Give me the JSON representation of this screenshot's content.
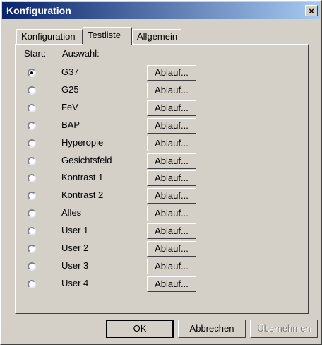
{
  "window": {
    "title": "Konfiguration",
    "close_label": "×"
  },
  "tabs": [
    {
      "label": "Konfiguration",
      "active": false
    },
    {
      "label": "Testliste",
      "active": true
    },
    {
      "label": "Allgemein",
      "active": false
    }
  ],
  "columns": {
    "start": "Start:",
    "auswahl": "Auswahl:"
  },
  "tests": [
    {
      "label": "G37",
      "checked": true,
      "button": "Ablauf..."
    },
    {
      "label": "G25",
      "checked": false,
      "button": "Ablauf..."
    },
    {
      "label": "FeV",
      "checked": false,
      "button": "Ablauf..."
    },
    {
      "label": "BAP",
      "checked": false,
      "button": "Ablauf..."
    },
    {
      "label": "Hyperopie",
      "checked": false,
      "button": "Ablauf..."
    },
    {
      "label": "Gesichtsfeld",
      "checked": false,
      "button": "Ablauf..."
    },
    {
      "label": "Kontrast 1",
      "checked": false,
      "button": "Ablauf..."
    },
    {
      "label": "Kontrast 2",
      "checked": false,
      "button": "Ablauf..."
    },
    {
      "label": "Alles",
      "checked": false,
      "button": "Ablauf..."
    },
    {
      "label": "User 1",
      "checked": false,
      "button": "Ablauf..."
    },
    {
      "label": "User 2",
      "checked": false,
      "button": "Ablauf..."
    },
    {
      "label": "User 3",
      "checked": false,
      "button": "Ablauf..."
    },
    {
      "label": "User 4",
      "checked": false,
      "button": "Ablauf..."
    }
  ],
  "buttons": {
    "ok": "OK",
    "cancel": "Abbrechen",
    "apply": "Übernehmen"
  }
}
